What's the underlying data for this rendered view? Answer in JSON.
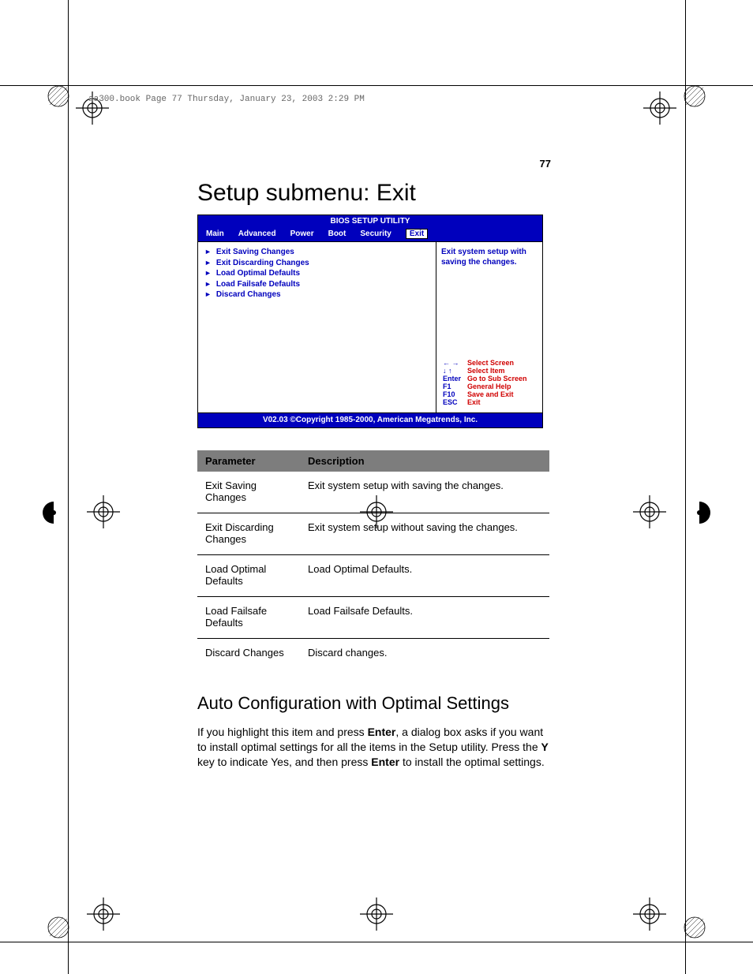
{
  "header_line": "aa300.book  Page 77  Thursday, January 23, 2003  2:29 PM",
  "page_number": "77",
  "heading": "Setup submenu: Exit",
  "bios": {
    "title": "BIOS SETUP UTILITY",
    "tabs": [
      "Main",
      "Advanced",
      "Power",
      "Boot",
      "Security",
      "Exit"
    ],
    "selected_tab": "Exit",
    "menu_items": [
      "Exit Saving Changes",
      "Exit Discarding Changes",
      "Load Optimal Defaults",
      "Load Failsafe Defaults",
      "Discard Changes"
    ],
    "side_desc": "Exit system setup with saving the changes.",
    "keys": [
      {
        "key": "← →",
        "label": "Select Screen"
      },
      {
        "key": "↓ ↑",
        "label": "Select Item"
      },
      {
        "key": "Enter",
        "label": "Go to Sub Screen"
      },
      {
        "key": "F1",
        "label": "General Help"
      },
      {
        "key": "F10",
        "label": "Save and Exit"
      },
      {
        "key": "ESC",
        "label": "Exit"
      }
    ],
    "footer": "V02.03 ©Copyright 1985-2000, American Megatrends, Inc."
  },
  "table": {
    "headers": [
      "Parameter",
      "Description"
    ],
    "rows": [
      [
        "Exit Saving Changes",
        "Exit system setup with saving the changes."
      ],
      [
        "Exit Discarding Changes",
        "Exit system setup without saving the changes."
      ],
      [
        "Load Optimal Defaults",
        "Load Optimal Defaults."
      ],
      [
        "Load Failsafe Defaults",
        "Load Failsafe Defaults."
      ],
      [
        "Discard Changes",
        "Discard changes."
      ]
    ]
  },
  "subheading": "Auto Configuration with Optimal Settings",
  "para": {
    "t1": "If you highlight this item and press ",
    "b1": "Enter",
    "t2": ", a dialog box asks if you want to install optimal settings for all the items in the Setup utility. Press the ",
    "b2": "Y",
    "t3": " key to indicate Yes, and then press ",
    "b3": "Enter",
    "t4": " to install the optimal settings."
  }
}
